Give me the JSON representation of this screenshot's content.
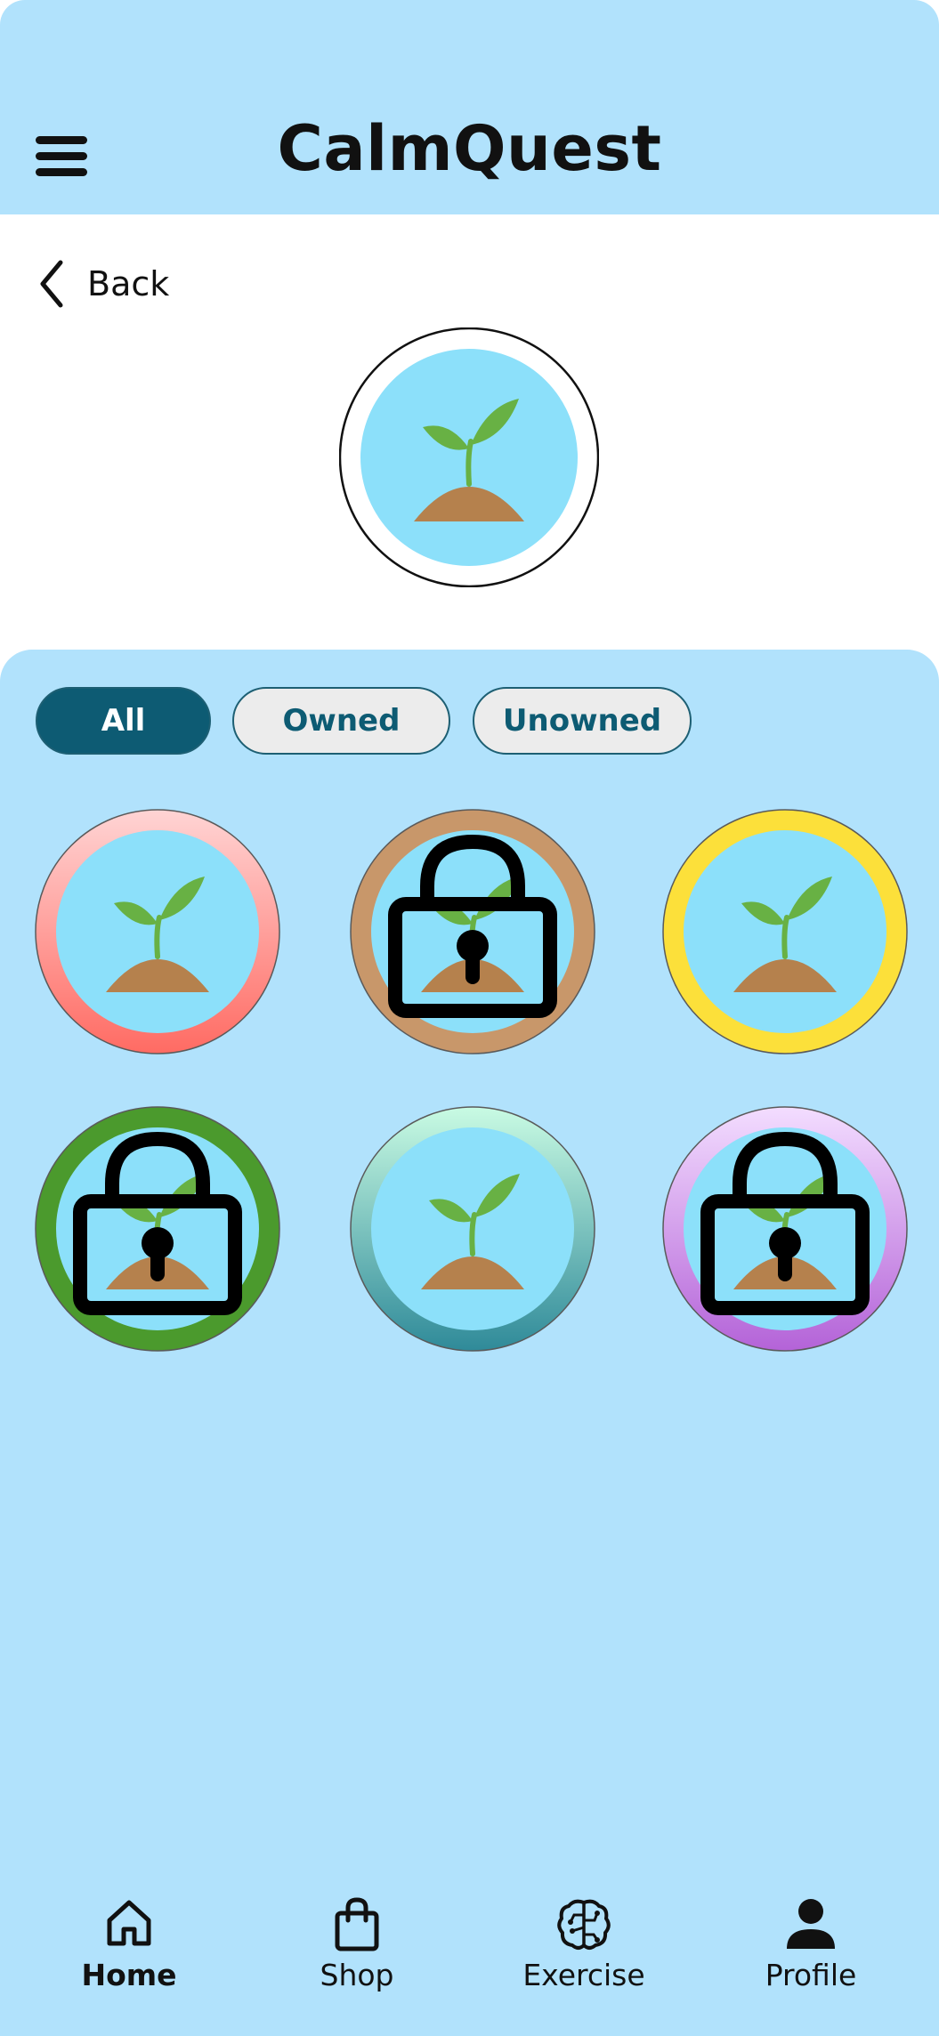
{
  "header": {
    "title": "CalmQuest",
    "menu_icon": "hamburger-menu-icon"
  },
  "back": {
    "label": "Back",
    "icon": "chevron-left-icon"
  },
  "selected_avatar": {
    "icon": "sprout-icon",
    "ring_color": "#ffffff"
  },
  "filters": [
    {
      "label": "All",
      "active": true
    },
    {
      "label": "Owned",
      "active": false
    },
    {
      "label": "Unowned",
      "active": false
    }
  ],
  "avatars": [
    {
      "ring": "red-gradient",
      "colors": [
        "#ffd4d4",
        "#ff6b63"
      ],
      "locked": false
    },
    {
      "ring": "brown",
      "colors": [
        "#c8976a",
        "#c8976a"
      ],
      "locked": true
    },
    {
      "ring": "yellow",
      "colors": [
        "#fce03a",
        "#fce03a"
      ],
      "locked": false
    },
    {
      "ring": "green",
      "colors": [
        "#4b9a2d",
        "#4b9a2d"
      ],
      "locked": true
    },
    {
      "ring": "teal-gradient",
      "colors": [
        "#c9fbe3",
        "#2f8a99"
      ],
      "locked": false
    },
    {
      "ring": "purple-gradient",
      "colors": [
        "#f3ddff",
        "#b463d8"
      ],
      "locked": true
    }
  ],
  "nav": {
    "home": {
      "label": "Home",
      "icon": "home-icon",
      "active": true
    },
    "shop": {
      "label": "Shop",
      "icon": "shopping-bag-icon",
      "active": false
    },
    "exercise": {
      "label": "Exercise",
      "icon": "brain-icon",
      "active": false
    },
    "profile": {
      "label": "Profile",
      "icon": "person-icon",
      "active": false
    }
  },
  "colors": {
    "header_bg": "#b1e2fc",
    "panel_bg": "#b1e2fc",
    "accent": "#0d5b73",
    "avatar_inner": "#8ce0fa",
    "soil": "#b5814d",
    "leaf": "#68b144"
  }
}
